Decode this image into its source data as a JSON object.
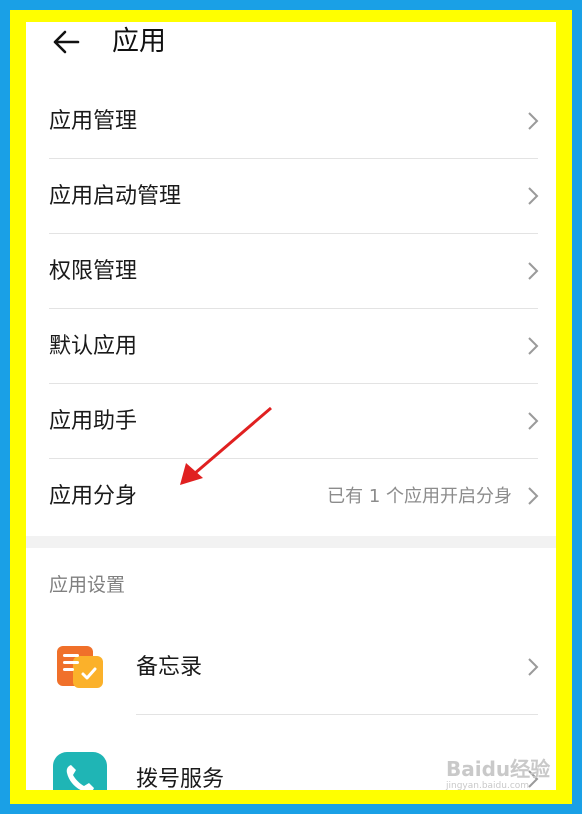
{
  "header": {
    "title": "应用"
  },
  "menu": [
    {
      "label": "应用管理",
      "value": ""
    },
    {
      "label": "应用启动管理",
      "value": ""
    },
    {
      "label": "权限管理",
      "value": ""
    },
    {
      "label": "默认应用",
      "value": ""
    },
    {
      "label": "应用助手",
      "value": ""
    },
    {
      "label": "应用分身",
      "value": "已有 1 个应用开启分身"
    }
  ],
  "section": {
    "title": "应用设置"
  },
  "apps": [
    {
      "label": "备忘录",
      "icon": "notes-icon",
      "color": "#f39c12"
    },
    {
      "label": "拨号服务",
      "icon": "phone-icon",
      "color": "#1fb5b5"
    }
  ],
  "colors": {
    "outer_border": "#1aa0e6",
    "frame": "#ffff00",
    "annotation_arrow": "#e02020"
  },
  "watermark": {
    "main": "Baidu经验",
    "sub": "jingyan.baidu.com"
  }
}
